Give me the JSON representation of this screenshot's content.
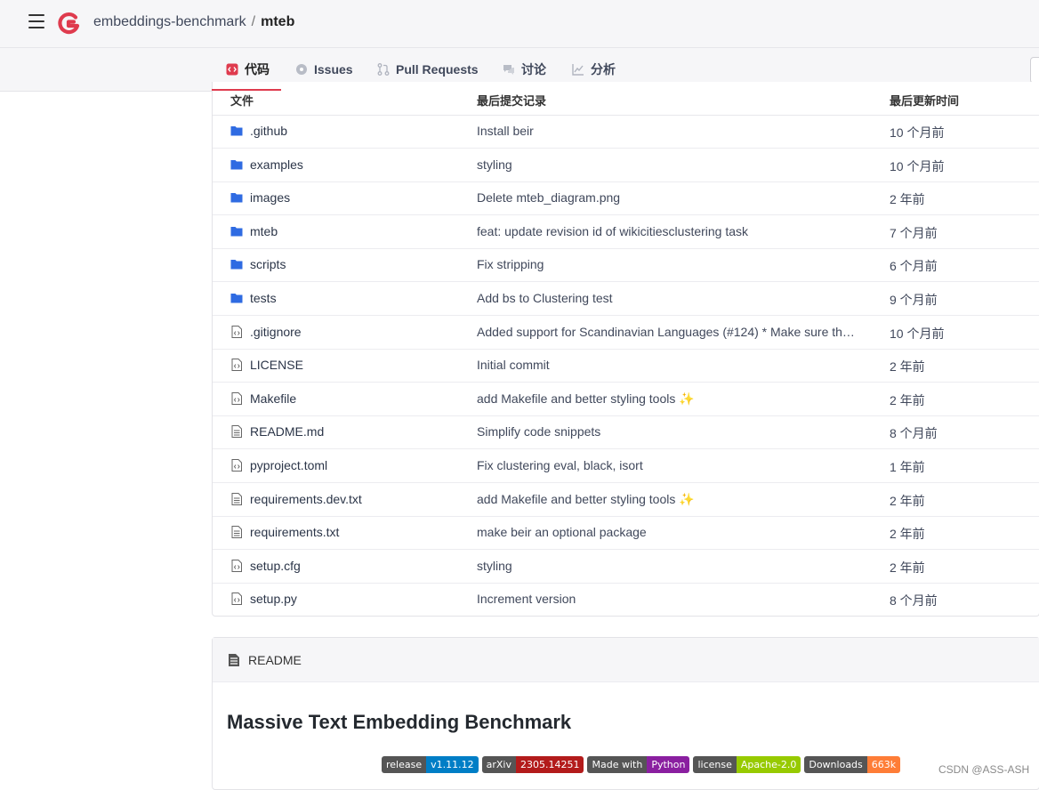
{
  "header": {
    "owner": "embeddings-benchmark",
    "separator": "/",
    "repo": "mteb"
  },
  "tabs": [
    {
      "label": "代码",
      "icon": "code-icon"
    },
    {
      "label": "Issues",
      "icon": "issue-icon"
    },
    {
      "label": "Pull Requests",
      "icon": "pull-request-icon"
    },
    {
      "label": "讨论",
      "icon": "discussion-icon"
    },
    {
      "label": "分析",
      "icon": "chart-icon"
    }
  ],
  "table": {
    "columns": {
      "file": "文件",
      "commit": "最后提交记录",
      "time": "最后更新时间"
    },
    "rows": [
      {
        "type": "folder",
        "name": ".github",
        "commit": "Install beir",
        "time": "10 个月前"
      },
      {
        "type": "folder",
        "name": "examples",
        "commit": "styling",
        "time": "10 个月前"
      },
      {
        "type": "folder",
        "name": "images",
        "commit": "Delete mteb_diagram.png",
        "time": "2 年前"
      },
      {
        "type": "folder",
        "name": "mteb",
        "commit": "feat: update revision id of wikicitiesclustering task",
        "time": "7 个月前"
      },
      {
        "type": "folder",
        "name": "scripts",
        "commit": "Fix stripping",
        "time": "6 个月前"
      },
      {
        "type": "folder",
        "name": "tests",
        "commit": "Add bs to Clustering test",
        "time": "9 个月前"
      },
      {
        "type": "code",
        "name": ".gitignore",
        "commit": "Added support for Scandinavian Languages (#124) * Make sure th…",
        "time": "10 个月前"
      },
      {
        "type": "code",
        "name": "LICENSE",
        "commit": "Initial commit",
        "time": "2 年前"
      },
      {
        "type": "code",
        "name": "Makefile",
        "commit": "add Makefile and better styling tools ✨",
        "time": "2 年前"
      },
      {
        "type": "text",
        "name": "README.md",
        "commit": "Simplify code snippets",
        "time": "8 个月前"
      },
      {
        "type": "code",
        "name": "pyproject.toml",
        "commit": "Fix clustering eval, black, isort",
        "time": "1 年前"
      },
      {
        "type": "text",
        "name": "requirements.dev.txt",
        "commit": "add Makefile and better styling tools ✨",
        "time": "2 年前"
      },
      {
        "type": "text",
        "name": "requirements.txt",
        "commit": "make beir an optional package",
        "time": "2 年前"
      },
      {
        "type": "code",
        "name": "setup.cfg",
        "commit": "styling",
        "time": "2 年前"
      },
      {
        "type": "code",
        "name": "setup.py",
        "commit": "Increment version",
        "time": "8 个月前"
      }
    ]
  },
  "readme": {
    "label": "README",
    "title": "Massive Text Embedding Benchmark",
    "badges": [
      {
        "left": "release",
        "right": "v1.11.12",
        "color": "#007ec6"
      },
      {
        "left": "arXiv",
        "right": "2305.14251",
        "color": "#b31b1b"
      },
      {
        "left": "Made with",
        "right": "Python",
        "color": "#8a1fa0"
      },
      {
        "left": "license",
        "right": "Apache-2.0",
        "color": "#97ca00"
      },
      {
        "left": "Downloads",
        "right": "663k",
        "color": "#fe7d37"
      }
    ]
  },
  "watermark": "CSDN @ASS-ASH",
  "colors": {
    "accent": "#df3b4e",
    "folder": "#2f6be2",
    "link": "#2b3548"
  }
}
